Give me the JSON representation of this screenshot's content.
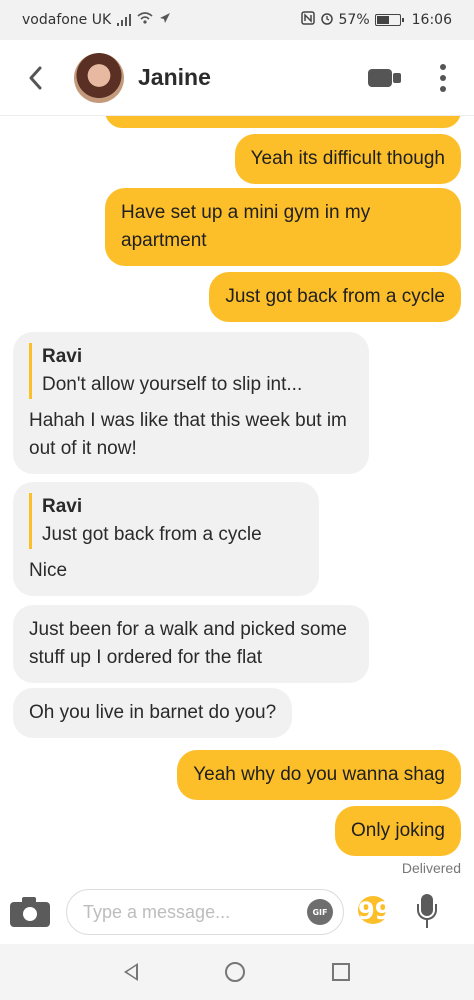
{
  "status_bar": {
    "carrier": "vodafone UK",
    "battery_percent": "57%",
    "battery_level": 0.57,
    "time": "16:06"
  },
  "header": {
    "contact_name": "Janine",
    "back_icon": "chevron-left-icon",
    "video_icon": "video-camera-icon",
    "menu_icon": "more-vertical-icon"
  },
  "messages": [
    {
      "dir": "out",
      "text": "Yeah its difficult though"
    },
    {
      "dir": "out",
      "text": "Have set up a mini gym in my apartment"
    },
    {
      "dir": "out",
      "text": "Just got back from a cycle"
    },
    {
      "dir": "in",
      "quote_name": "Ravi",
      "quote_text": "Don't allow yourself to slip int...",
      "text": "Hahah I was like that this week but im out of it now!"
    },
    {
      "dir": "in",
      "quote_name": "Ravi",
      "quote_text": "Just got back from a cycle",
      "text": "Nice"
    },
    {
      "dir": "in",
      "text": "Just been for a walk and picked some stuff up I ordered for the flat"
    },
    {
      "dir": "in",
      "text": "Oh you live in barnet do you?"
    },
    {
      "dir": "out",
      "text": "Yeah why do you wanna shag"
    },
    {
      "dir": "out",
      "text": "Only joking"
    }
  ],
  "delivered_label": "Delivered",
  "input": {
    "placeholder": "Type a message...",
    "gif_label": "GIF",
    "quote_glyph": "99"
  },
  "colors": {
    "accent": "#fcbf29",
    "incoming_bubble": "#f1f1f1"
  }
}
